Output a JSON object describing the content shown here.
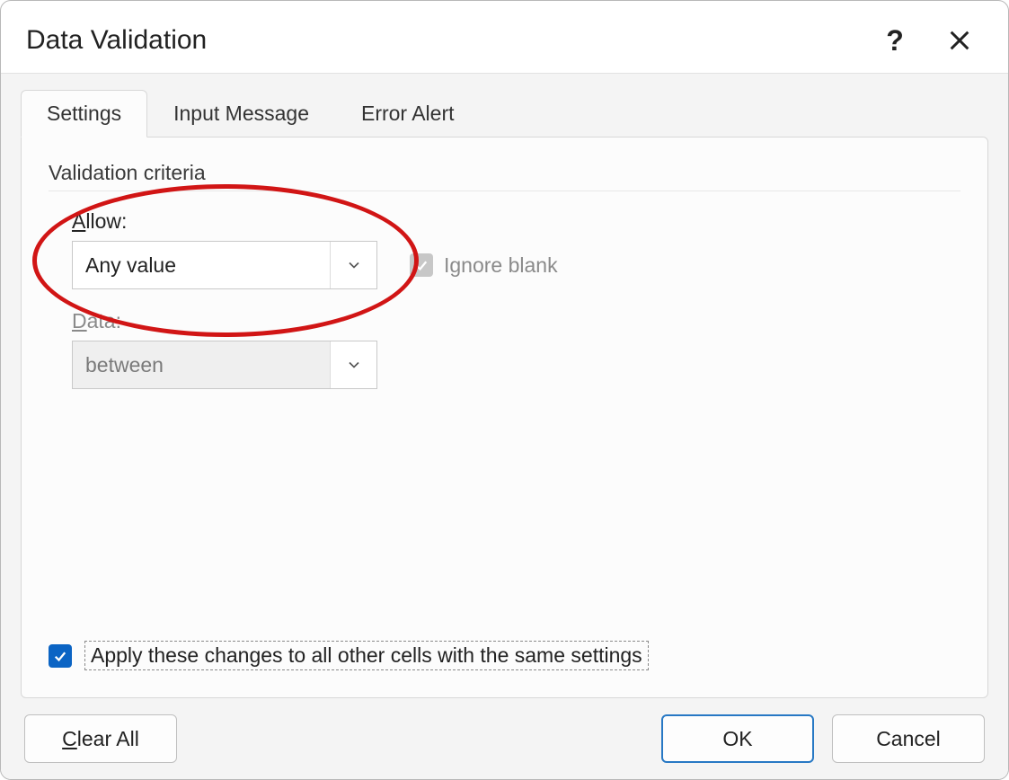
{
  "title": "Data Validation",
  "tabs": {
    "settings": "Settings",
    "inputMessage": "Input Message",
    "errorAlert": "Error Alert"
  },
  "section": {
    "criteria": "Validation criteria"
  },
  "labels": {
    "allow": "Allow:",
    "data": "Data:",
    "ignoreBlank": "Ignore blank",
    "applySame": "Apply these changes to all other cells with the same settings"
  },
  "values": {
    "allow": "Any value",
    "data": "between"
  },
  "state": {
    "ignoreBlankChecked": true,
    "ignoreBlankEnabled": false,
    "dataEnabled": false,
    "applySameChecked": true
  },
  "buttons": {
    "clearAll": "Clear All",
    "ok": "OK",
    "cancel": "Cancel"
  },
  "titlebar": {
    "help": "?",
    "close": "✕"
  }
}
